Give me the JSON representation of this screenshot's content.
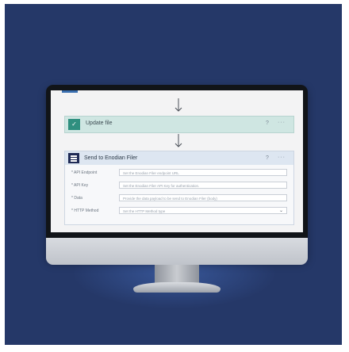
{
  "flow": {
    "update_card": {
      "title": "Update file",
      "help_icon": "help-circle-icon",
      "more_label": "···"
    },
    "enodian_card": {
      "title": "Send to Enodian Filer",
      "help_icon": "help-circle-icon",
      "more_label": "···",
      "fields": [
        {
          "label": "* API Endpoint",
          "placeholder": "Set the Enodian Filer endpoint URL"
        },
        {
          "label": "* API Key",
          "placeholder": "Set the Enodian Filer API Key for authentication."
        },
        {
          "label": "* Data",
          "placeholder": "Provide the data payload to be send to Enodian Filer (body)"
        },
        {
          "label": "* HTTP Method",
          "placeholder": "Set the HTTP Method type"
        }
      ]
    }
  },
  "colors": {
    "background": "#253868",
    "update_accent": "#2f8f7f",
    "enodian_accent": "#1f2a55"
  }
}
